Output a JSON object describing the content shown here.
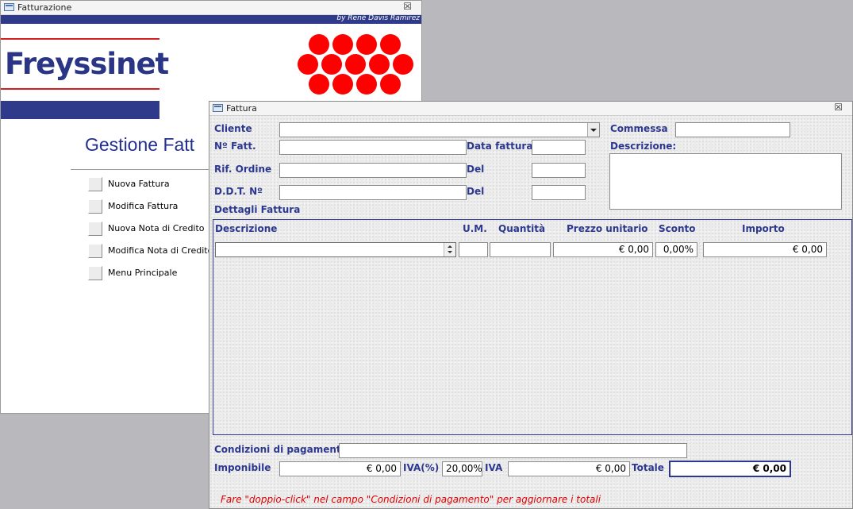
{
  "main_window": {
    "title": "Fatturazione",
    "byline": "by René Davis Ramirez",
    "logo_text": "Freyssinet",
    "heading": "Gestione Fatt",
    "menu": [
      "Nuova Fattura",
      "Modifica Fattura",
      "Nuova Nota di Credito",
      "Modifica Nota di Credito",
      "Menu Principale"
    ]
  },
  "invoice_window": {
    "title": "Fattura",
    "close_glyph": "☒",
    "labels": {
      "cliente": "Cliente",
      "commessa": "Commessa",
      "numero_fatt": "Nº Fatt.",
      "data_fattura": "Data fattura",
      "descrizione_header": "Descrizione:",
      "rif_ordine": "Rif. Ordine",
      "del1": "Del",
      "ddt": "D.D.T. Nº",
      "del2": "Del",
      "dettagli": "Dettagli Fattura",
      "condizioni": "Condizioni di pagamento",
      "imponibile": "Imponibile",
      "iva_pct": "IVA(%)",
      "iva": "IVA",
      "totale": "Totale"
    },
    "fields": {
      "cliente": "",
      "commessa": "",
      "numero_fatt": "",
      "data_fattura": "",
      "descrizione": "",
      "rif_ordine": "",
      "del1": "",
      "ddt": "",
      "del2": "",
      "condizioni": "",
      "imponibile": "€ 0,00",
      "iva_pct": "20,00%",
      "iva": "€ 0,00",
      "totale": "€ 0,00"
    },
    "details": {
      "columns": [
        "Descrizione",
        "U.M.",
        "Quantità",
        "Prezzo unitario",
        "Sconto",
        "Importo"
      ],
      "row": {
        "descrizione": "",
        "um": "",
        "quantita": "",
        "prezzo": "€ 0,00",
        "sconto": "0,00%",
        "importo": "€ 0,00"
      }
    },
    "note": "Fare \"doppio-click\" nel campo \"Condizioni di pagamento\" per aggiornare i totali"
  }
}
